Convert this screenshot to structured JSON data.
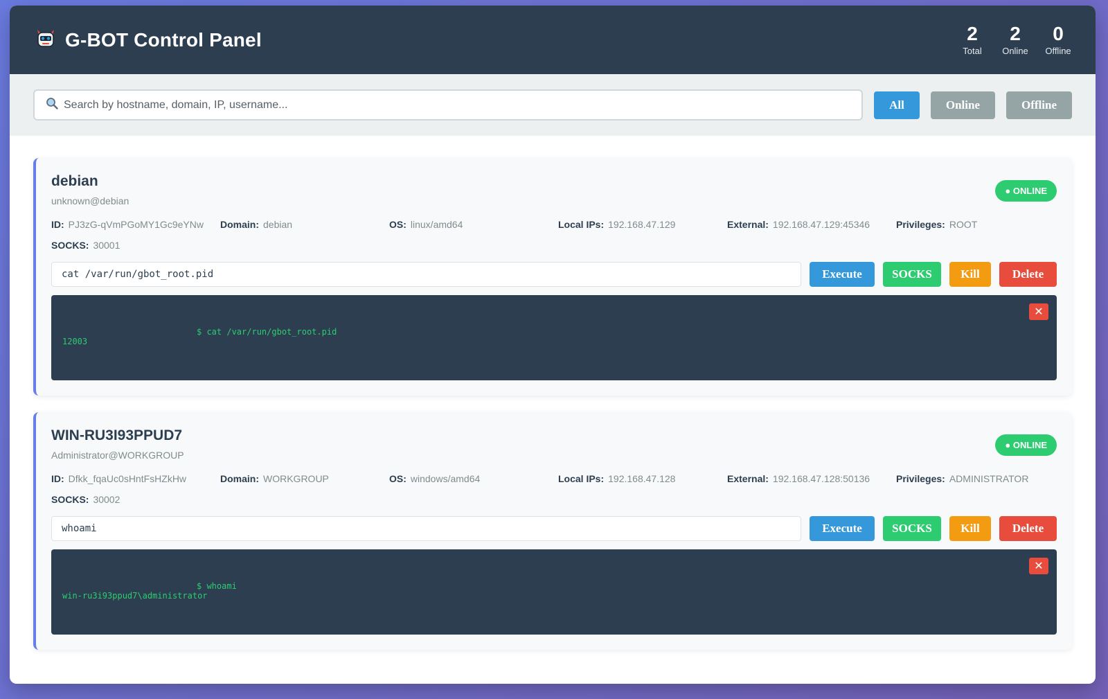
{
  "header": {
    "title": "G-BOT Control Panel",
    "logo_icon": "robot-icon",
    "stats": [
      {
        "value": "2",
        "label": "Total"
      },
      {
        "value": "2",
        "label": "Online"
      },
      {
        "value": "0",
        "label": "Offline"
      }
    ]
  },
  "toolbar": {
    "search_placeholder": "Search by hostname, domain, IP, username...",
    "search_icon": "search-icon",
    "filters": {
      "all": "All",
      "online": "Online",
      "offline": "Offline"
    }
  },
  "labels": {
    "id": "ID:",
    "domain": "Domain:",
    "os": "OS:",
    "local_ips": "Local IPs:",
    "external": "External:",
    "privileges": "Privileges:",
    "socks": "SOCKS:",
    "execute": "Execute",
    "socks_btn": "SOCKS",
    "kill": "Kill",
    "delete": "Delete",
    "close": "✕"
  },
  "bots": [
    {
      "hostname": "debian",
      "user": "unknown@debian",
      "status": "● ONLINE",
      "id": "PJ3zG-qVmPGoMY1Gc9eYNw",
      "domain": "debian",
      "os": "linux/amd64",
      "local_ips": "192.168.47.129",
      "external": "192.168.47.129:45346",
      "privileges": "ROOT",
      "socks": "30001",
      "command": "cat /var/run/gbot_root.pid",
      "output_cmd": "$ cat /var/run/gbot_root.pid",
      "output_result": "12003"
    },
    {
      "hostname": "WIN-RU3I93PPUD7",
      "user": "Administrator@WORKGROUP",
      "status": "● ONLINE",
      "id": "Dfkk_fqaUc0sHntFsHZkHw",
      "domain": "WORKGROUP",
      "os": "windows/amd64",
      "local_ips": "192.168.47.128",
      "external": "192.168.47.128:50136",
      "privileges": "ADMINISTRATOR",
      "socks": "30002",
      "command": "whoami",
      "output_cmd": "$ whoami",
      "output_result": "win-ru3i93ppud7\\administrator"
    }
  ],
  "colors": {
    "header_bg": "#2c3e50",
    "accent": "#667eea",
    "execute": "#3498db",
    "socks": "#2ecc71",
    "kill": "#f39c12",
    "delete": "#e74c3c"
  }
}
